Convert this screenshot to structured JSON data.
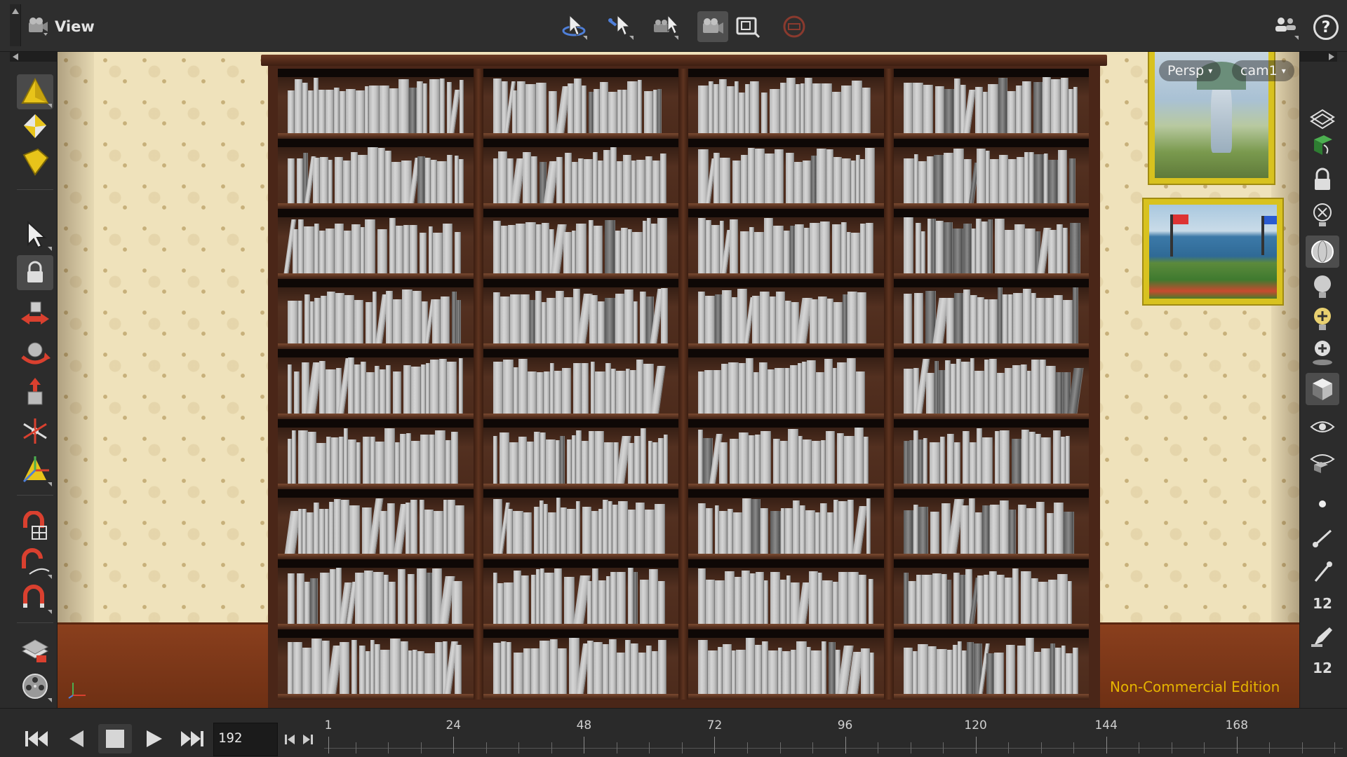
{
  "header": {
    "title": "View",
    "tools": [
      {
        "name": "select-orbit-tool",
        "icon": "orbit-arrow-icon"
      },
      {
        "name": "select-pose-tool",
        "icon": "pose-arrow-icon"
      },
      {
        "name": "camera-tool",
        "icon": "camera-arrow-icon"
      },
      {
        "name": "camera-view-tool",
        "icon": "camera-icon",
        "active": true
      },
      {
        "name": "zoom-fit-tool",
        "icon": "zoom-frame-icon"
      },
      {
        "name": "stop-render-tool",
        "icon": "no-sign-icon"
      }
    ],
    "help_label": "?"
  },
  "viewport": {
    "persp_label": "Persp",
    "camera_label": "cam1",
    "edition_label": "Non-Commercial Edition"
  },
  "right_toolbar": {
    "value_a": "12",
    "value_b": "12"
  },
  "timeline": {
    "current_frame": "192",
    "tick_labels": [
      "1",
      "24",
      "48",
      "72",
      "96",
      "120",
      "144",
      "168"
    ]
  },
  "colors": {
    "accent_yellow": "#e6b400",
    "frame_gold": "#d8c21f",
    "wallpaper": "#efe2bb",
    "wood_dark": "#4a2618",
    "books_gray": "#c4c4c4"
  }
}
